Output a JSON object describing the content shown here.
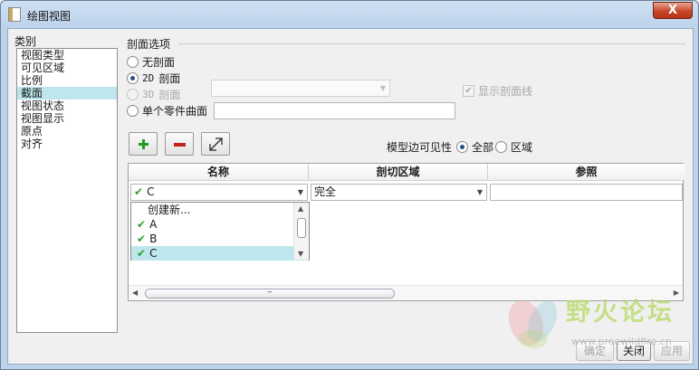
{
  "window": {
    "title": "绘图视图",
    "close_label": "X"
  },
  "categories": {
    "label": "类别",
    "items": [
      "视图类型",
      "可见区域",
      "比例",
      "截面",
      "视图状态",
      "视图显示",
      "原点",
      "对齐"
    ],
    "selected_index": 3
  },
  "section": {
    "title": "剖面选项",
    "radio_no_section": "无剖面",
    "radio_2d_prefix": "2D",
    "radio_2d_label": "剖面",
    "radio_3d_prefix": "3D",
    "radio_3d_label": "剖面",
    "radio_single_part": "单个零件曲面",
    "show_section_lines": "显示剖面线",
    "selected_option": "2D 剖面"
  },
  "toolbar": {
    "add_icon": "plus-icon",
    "remove_icon": "minus-icon",
    "flip_icon": "flip-arrows-icon"
  },
  "edge_visibility": {
    "label": "模型边可见性",
    "option_full": "全部",
    "option_area": "区域",
    "selected": "全部"
  },
  "table": {
    "columns": [
      "名称",
      "剖切区域",
      "参照"
    ],
    "row": {
      "name": "C",
      "area": "完全",
      "reference": ""
    },
    "name_dropdown": [
      "创建新...",
      "A",
      "B",
      "C"
    ],
    "name_dropdown_checked": [
      "A",
      "B",
      "C"
    ],
    "name_dropdown_selected": "C"
  },
  "buttons": {
    "ok": "确定",
    "close": "关闭",
    "apply": "应用"
  },
  "watermark": {
    "text": "野火论坛",
    "url": "www.proewildfire.cn"
  },
  "colors": {
    "selection": "#bde7ec",
    "plus": "#1f9b1f",
    "minus": "#c51e1e",
    "check": "#2ea32e"
  }
}
